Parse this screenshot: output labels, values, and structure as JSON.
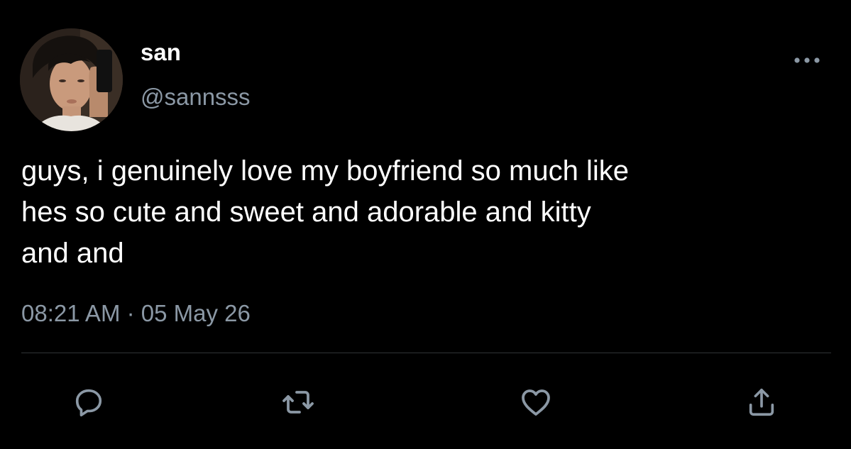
{
  "user": {
    "display_name": "san",
    "handle": "@sannsss",
    "avatar": "profile-photo"
  },
  "tweet": {
    "text": "guys, i genuinely love my boyfriend so much like\nhes so cute and sweet and adorable and kitty\nand and",
    "timestamp": "08:21 AM · 05 May 26"
  },
  "actions": {
    "more": "more-icon",
    "reply": "reply-icon",
    "retweet": "retweet-icon",
    "like": "heart-icon",
    "share": "share-icon"
  },
  "colors": {
    "background": "#000000",
    "primary_text": "#ffffff",
    "secondary_text": "#8b98a5",
    "icon": "#8b98a5",
    "divider": "#2f3336"
  }
}
